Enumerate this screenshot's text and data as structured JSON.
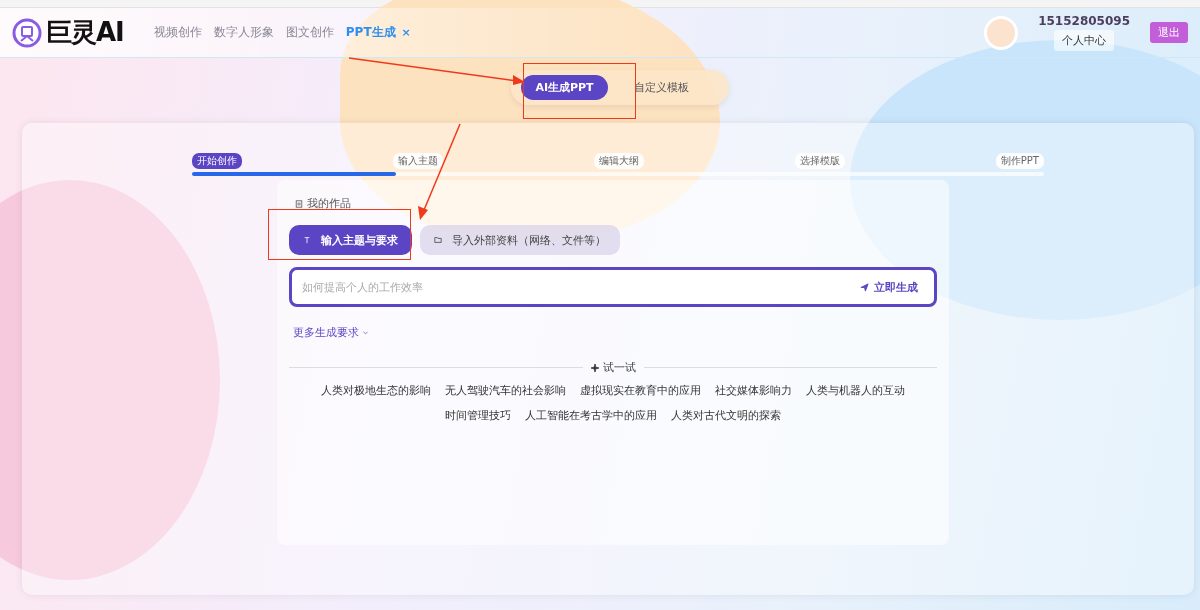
{
  "header": {
    "logo": "巨灵AI",
    "nav": [
      {
        "label": "视频创作",
        "selected": false
      },
      {
        "label": "数字人形象",
        "selected": false
      },
      {
        "label": "图文创作",
        "selected": false
      },
      {
        "label": "PPT生成",
        "selected": true,
        "closable": "×"
      }
    ],
    "user": {
      "phone": "15152805095",
      "center": "个人中心",
      "logout": "退出"
    }
  },
  "modes": [
    {
      "label": "AI生成PPT",
      "selected": true
    },
    {
      "label": "自定义模板",
      "selected": false
    }
  ],
  "stepper": {
    "level": 0.24,
    "steps": [
      {
        "label": "开始创作",
        "selected": true
      },
      {
        "label": "输入主题",
        "selected": false
      },
      {
        "label": "编辑大纲",
        "selected": false
      },
      {
        "label": "选择模版",
        "selected": false
      },
      {
        "label": "制作PPT",
        "selected": false
      }
    ]
  },
  "works": "我的作品",
  "input_tabs": [
    {
      "label": "输入主题与要求",
      "selected": true,
      "kind": "text"
    },
    {
      "label": "导入外部资料（网络、文件等）",
      "selected": false,
      "kind": "folder"
    }
  ],
  "prompt": {
    "placeholder": "如何提高个人的工作效率",
    "submit": "立即生成"
  },
  "more": "更多生成要求",
  "try": {
    "title": "试一试",
    "items": [
      "人类对极地生态的影响",
      "无人驾驶汽车的社会影响",
      "虚拟现实在教育中的应用",
      "社交媒体影响力",
      "人类与机器人的互动",
      "时间管理技巧",
      "人工智能在考古学中的应用",
      "人类对古代文明的探索"
    ]
  }
}
